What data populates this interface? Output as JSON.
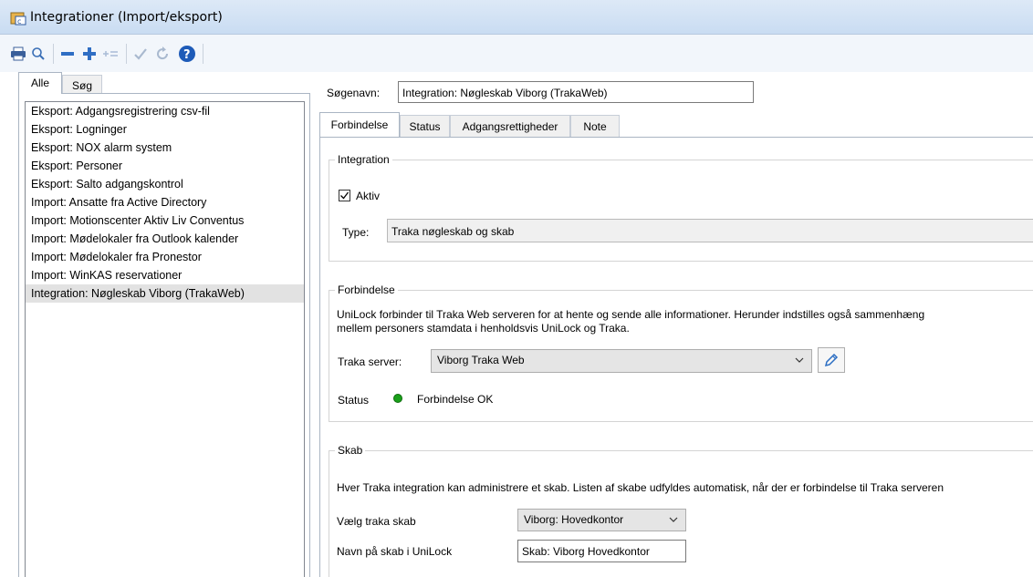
{
  "window": {
    "title": "Integrationer  (Import/eksport)"
  },
  "toolbar": {
    "icons": [
      "printer-icon",
      "search-icon",
      "minus-icon",
      "plus-icon",
      "insert-icon",
      "check-icon",
      "refresh-icon",
      "help-icon"
    ]
  },
  "left_tabs": [
    "Alle",
    "Søg"
  ],
  "left_list": [
    "Eksport: Adgangsregistrering csv-fil",
    "Eksport: Logninger",
    "Eksport: NOX alarm system",
    "Eksport: Personer",
    "Eksport: Salto adgangskontrol",
    "Import: Ansatte fra Active Directory",
    "Import: Motionscenter Aktiv Liv Conventus",
    "Import: Mødelokaler fra Outlook kalender",
    "Import: Mødelokaler fra Pronestor",
    "Import: WinKAS reservationer",
    "Integration: Nøgleskab Viborg (TrakaWeb)"
  ],
  "selected_index": 10,
  "search": {
    "label": "Søgenavn:",
    "value": "Integration: Nøgleskab Viborg (TrakaWeb)"
  },
  "tabs": [
    "Forbindelse",
    "Status",
    "Adgangsrettigheder",
    "Note"
  ],
  "integration": {
    "legend": "Integration",
    "active_label": "Aktiv",
    "active_checked": true,
    "type_label": "Type:",
    "type_value": "Traka nøgleskab og skab"
  },
  "connection": {
    "legend": "Forbindelse",
    "description_line1": "UniLock forbinder til Traka Web serveren for at hente og sende alle informationer. Herunder indstilles også sammenhæng",
    "description_line2": "mellem personers stamdata i henholdsvis UniLock og Traka.",
    "server_label": "Traka server:",
    "server_value": "Viborg Traka Web",
    "status_label": "Status",
    "status_text": "Forbindelse OK",
    "status_color": "#1aa01a"
  },
  "cabinet": {
    "legend": "Skab",
    "description": "Hver Traka integration kan administrere et skab. Listen af skabe udfyldes automatisk, når der er forbindelse til Traka serveren",
    "select_label": "Vælg traka skab",
    "select_value": "Viborg: Hovedkontor",
    "name_label": "Navn på skab i UniLock",
    "name_value": "Skab: Viborg Hovedkontor"
  }
}
